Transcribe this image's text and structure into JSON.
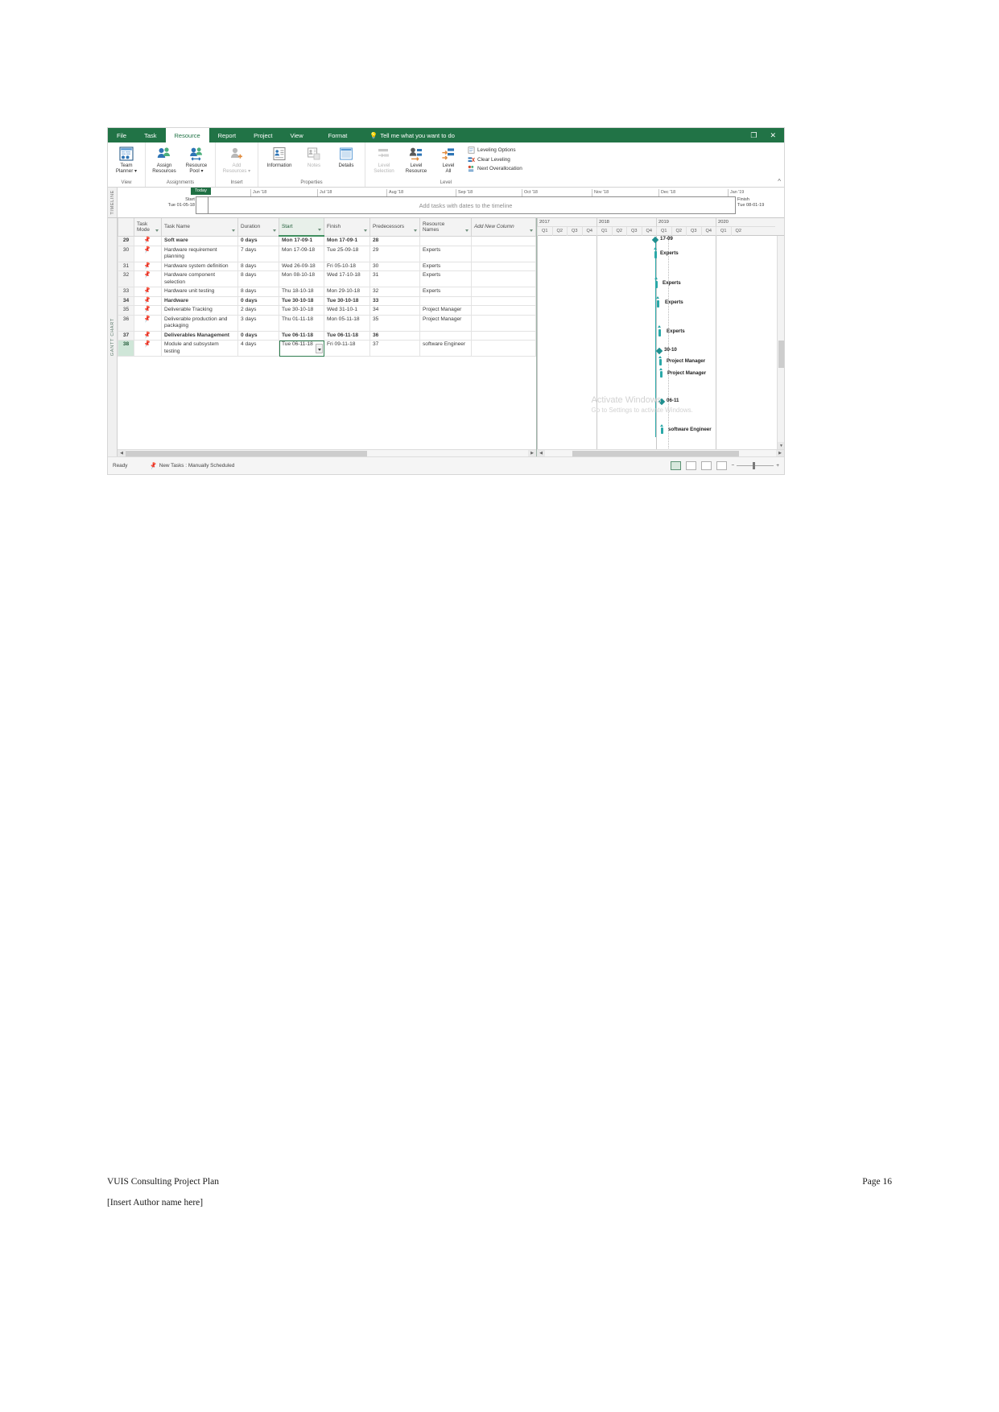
{
  "window": {
    "controls": {
      "restore": "❐",
      "close": "✕"
    }
  },
  "ribbon": {
    "tabs": [
      {
        "label": "File",
        "active": false
      },
      {
        "label": "Task",
        "active": false
      },
      {
        "label": "Resource",
        "active": true
      },
      {
        "label": "Report",
        "active": false
      },
      {
        "label": "Project",
        "active": false
      },
      {
        "label": "View",
        "active": false
      },
      {
        "label": "Format",
        "active": false,
        "contextual": true
      }
    ],
    "tell_me": "Tell me what you want to do",
    "collapse_icon": "chevron-up-icon",
    "groups": [
      {
        "label": "View",
        "buttons": [
          {
            "label": "Team\nPlanner ▾",
            "icon": "team-planner-icon",
            "disabled": false
          }
        ]
      },
      {
        "label": "Assignments",
        "buttons": [
          {
            "label": "Assign\nResources",
            "icon": "assign-resources-icon",
            "disabled": false
          },
          {
            "label": "Resource\nPool ▾",
            "icon": "resource-pool-icon",
            "disabled": false
          }
        ]
      },
      {
        "label": "Insert",
        "buttons": [
          {
            "label": "Add\nResources ▾",
            "icon": "add-resources-icon",
            "disabled": true
          }
        ]
      },
      {
        "label": "Properties",
        "buttons": [
          {
            "label": "Information",
            "icon": "information-icon",
            "disabled": false
          },
          {
            "label": "Notes",
            "icon": "notes-icon",
            "disabled": true
          },
          {
            "label": "Details",
            "icon": "details-icon",
            "disabled": false
          }
        ]
      },
      {
        "label": "Level",
        "buttons": [
          {
            "label": "Level\nSelection",
            "icon": "level-selection-icon",
            "disabled": true
          },
          {
            "label": "Level\nResource",
            "icon": "level-resource-icon",
            "disabled": false
          },
          {
            "label": "Level\nAll",
            "icon": "level-all-icon",
            "disabled": false
          }
        ],
        "small_items": [
          {
            "label": "Leveling Options",
            "icon": "leveling-options-icon"
          },
          {
            "label": "Clear Leveling",
            "icon": "clear-leveling-icon"
          },
          {
            "label": "Next Overallocation",
            "icon": "next-overallocation-icon"
          }
        ]
      }
    ]
  },
  "timeline": {
    "vertical_label": "TIMELINE",
    "today_label": "Today",
    "start_caption": "Start",
    "start_date": "Tue 01-05-18",
    "finish_caption": "Finish",
    "finish_date": "Tue 08-01-19",
    "placeholder": "Add tasks with dates to the timeline",
    "ticks": [
      "Jun '18",
      "Jul '18",
      "Aug '18",
      "Sep '18",
      "Oct '18",
      "Nov '18",
      "Dec '18",
      "Jan '19"
    ]
  },
  "gantt_view": {
    "vertical_label": "GANTT CHART"
  },
  "grid": {
    "columns": [
      {
        "key": "id",
        "label": "",
        "cls": "colw-id"
      },
      {
        "key": "mode",
        "label": "Task\nMode",
        "cls": "colw-mode"
      },
      {
        "key": "name",
        "label": "Task Name",
        "cls": "colw-name"
      },
      {
        "key": "duration",
        "label": "Duration",
        "cls": "colw-dur"
      },
      {
        "key": "start",
        "label": "Start",
        "cls": "colw-start",
        "sorted": true
      },
      {
        "key": "finish",
        "label": "Finish",
        "cls": "colw-fin"
      },
      {
        "key": "predecessors",
        "label": "Predecessors",
        "cls": "colw-pred"
      },
      {
        "key": "resource",
        "label": "Resource\nNames",
        "cls": "colw-res"
      },
      {
        "key": "addnew",
        "label": "Add New Column",
        "cls": "colw-add"
      }
    ],
    "rows": [
      {
        "id": "29",
        "mode": "manual-pin-icon",
        "name": "Soft ware",
        "duration": "0 days",
        "start": "Mon 17-09-1",
        "finish": "Mon 17-09-1",
        "predecessors": "28",
        "resource": "",
        "summary": true
      },
      {
        "id": "30",
        "mode": "manual-pin-icon",
        "name": "Hardware requirement planning",
        "duration": "7 days",
        "start": "Mon 17-09-18",
        "finish": "Tue 25-09-18",
        "predecessors": "29",
        "resource": "Experts"
      },
      {
        "id": "31",
        "mode": "manual-pin-icon",
        "name": "Hardware system definition",
        "duration": "8 days",
        "start": "Wed 26-09-18",
        "finish": "Fri 05-10-18",
        "predecessors": "30",
        "resource": "Experts"
      },
      {
        "id": "32",
        "mode": "manual-pin-icon",
        "name": "Hardware component selection",
        "duration": "8 days",
        "start": "Mon 08-10-18",
        "finish": "Wed 17-10-18",
        "predecessors": "31",
        "resource": "Experts"
      },
      {
        "id": "33",
        "mode": "manual-pin-icon",
        "name": "Hardware unit testing",
        "duration": "8 days",
        "start": "Thu 18-10-18",
        "finish": "Mon 29-10-18",
        "predecessors": "32",
        "resource": "Experts"
      },
      {
        "id": "34",
        "mode": "manual-pin-icon",
        "name": "Hardware",
        "duration": "0 days",
        "start": "Tue 30-10-18",
        "finish": "Tue 30-10-18",
        "predecessors": "33",
        "resource": "",
        "summary": true
      },
      {
        "id": "35",
        "mode": "manual-pin-icon",
        "name": "Deliverable Tracking",
        "duration": "2 days",
        "start": "Tue 30-10-18",
        "finish": "Wed 31-10-1",
        "predecessors": "34",
        "resource": "Project Manager"
      },
      {
        "id": "36",
        "mode": "manual-pin-icon",
        "name": "Deliverable production and packaging",
        "duration": "3 days",
        "start": "Thu 01-11-18",
        "finish": "Mon 05-11-18",
        "predecessors": "35",
        "resource": "Project Manager"
      },
      {
        "id": "37",
        "mode": "manual-pin-icon",
        "name": "Deliverables Management",
        "duration": "0 days",
        "start": "Tue 06-11-18",
        "finish": "Tue 06-11-18",
        "predecessors": "36",
        "resource": "",
        "summary": true
      },
      {
        "id": "38",
        "mode": "manual-pin-icon",
        "name": "Module and subsystem testing",
        "duration": "4 days",
        "start": "Tue 06-11-18",
        "finish": "Fri 09-11-18",
        "predecessors": "37",
        "resource": "software Engineer",
        "selected": true,
        "cell_selected": "start"
      }
    ]
  },
  "chart_data": {
    "type": "bar",
    "title": "Gantt Chart",
    "years": [
      "2017",
      "2018",
      "2019",
      "2020"
    ],
    "quarters": [
      "Q1",
      "Q2",
      "Q3",
      "Q4"
    ],
    "bars": [
      {
        "row": 29,
        "label": "17-09",
        "kind": "milestone",
        "start": "2018-Q4",
        "finish": "2018-Q4"
      },
      {
        "row": 30,
        "label": "Experts",
        "kind": "bar",
        "start": "17-09-18",
        "finish": "25-09-18"
      },
      {
        "row": 31,
        "label": "Experts",
        "kind": "bar",
        "start": "26-09-18",
        "finish": "05-10-18"
      },
      {
        "row": 32,
        "label": "Experts",
        "kind": "bar",
        "start": "08-10-18",
        "finish": "17-10-18"
      },
      {
        "row": 33,
        "label": "Experts",
        "kind": "bar",
        "start": "18-10-18",
        "finish": "29-10-18"
      },
      {
        "row": 34,
        "label": "30-10",
        "kind": "milestone",
        "start": "30-10-18",
        "finish": "30-10-18"
      },
      {
        "row": 35,
        "label": "Project Manager",
        "kind": "bar",
        "start": "30-10-18",
        "finish": "31-10-18"
      },
      {
        "row": 36,
        "label": "Project Manager",
        "kind": "bar",
        "start": "01-11-18",
        "finish": "05-11-18"
      },
      {
        "row": 37,
        "label": "06-11",
        "kind": "milestone",
        "start": "06-11-18",
        "finish": "06-11-18"
      },
      {
        "row": 38,
        "label": "software Engineer",
        "kind": "bar",
        "start": "06-11-18",
        "finish": "09-11-18"
      }
    ]
  },
  "watermark": {
    "line1": "Activate Windows",
    "line2": "Go to Settings to activate Windows."
  },
  "status_bar": {
    "ready": "Ready",
    "new_tasks": "New Tasks : Manually Scheduled",
    "new_tasks_icon": "pin-icon",
    "view_modes": [
      "gantt-chart-view-icon",
      "task-usage-view-icon",
      "team-planner-view-icon",
      "resource-sheet-view-icon"
    ],
    "zoom_out": "−",
    "zoom_in": "+"
  },
  "footer": {
    "doc_title": "VUIS Consulting Project Plan",
    "page_label": "Page 16",
    "author": "[Insert Author name here]"
  }
}
